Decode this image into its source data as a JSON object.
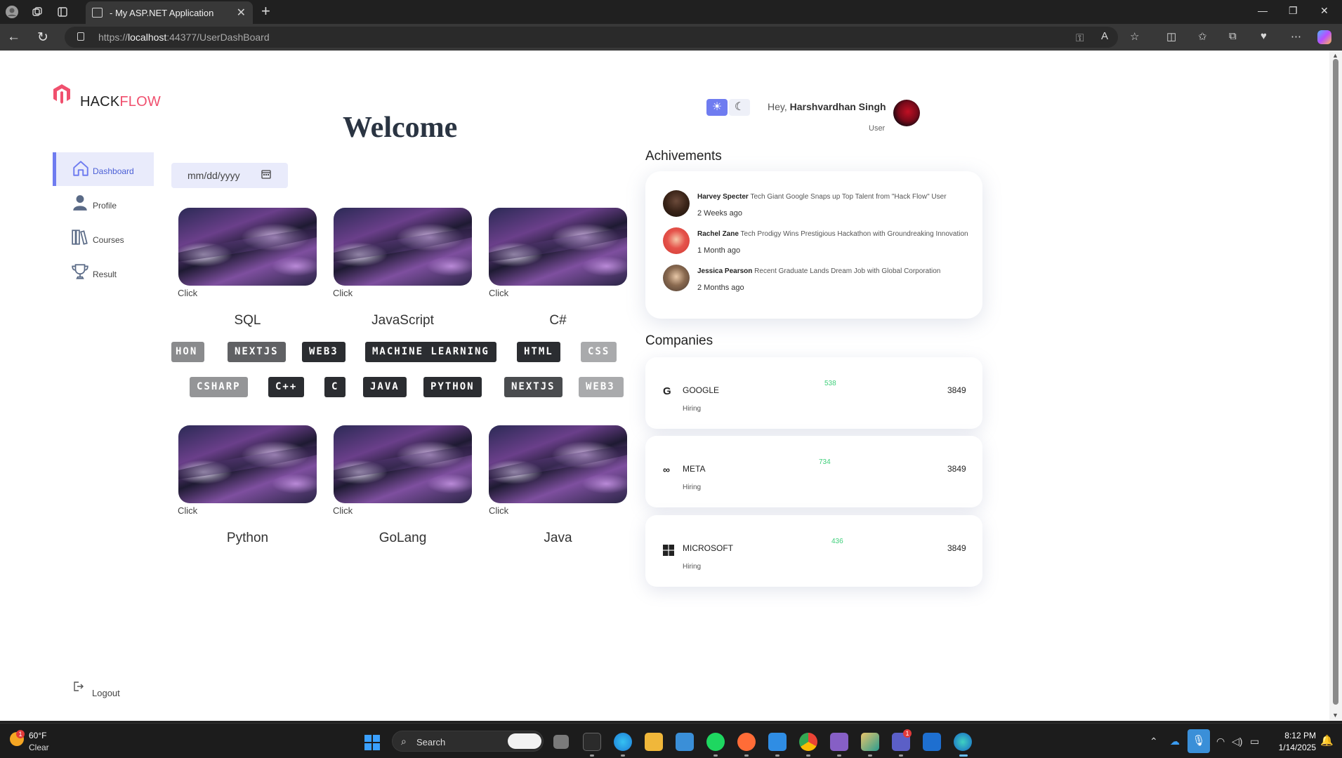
{
  "browser": {
    "tab_title": "- My ASP.NET Application",
    "url_prefix": "https://",
    "url_host": "localhost",
    "url_rest": ":44377/UserDashBoard"
  },
  "brand": {
    "name_part1": "HACK",
    "name_part2": "FLOW",
    "accent_color": "#f0506e"
  },
  "sidebar": {
    "items": [
      {
        "label": "Dashboard",
        "icon": "home-icon",
        "active": true
      },
      {
        "label": "Profile",
        "icon": "user-icon",
        "active": false
      },
      {
        "label": "Courses",
        "icon": "books-icon",
        "active": false
      },
      {
        "label": "Result",
        "icon": "trophy-icon",
        "active": false
      }
    ],
    "logout_label": "Logout"
  },
  "main": {
    "welcome": "Welcome",
    "date_placeholder": "mm/dd/yyyy",
    "click_label": "Click",
    "courses_row1": [
      "SQL",
      "JavaScript",
      "C#"
    ],
    "courses_row2": [
      "Python",
      "GoLang",
      "Java"
    ],
    "tags_row1": [
      "HON",
      "NEXTJS",
      "WEB3",
      "MACHINE LEARNING",
      "HTML",
      "CSS"
    ],
    "tags_row2": [
      "CSHARP",
      "C++",
      "C",
      "JAVA",
      "PYTHON",
      "NEXTJS",
      "WEB3"
    ]
  },
  "header": {
    "greeting": "Hey,",
    "user_name": "Harshvardhan Singh",
    "role": "User",
    "theme_light_icon": "sun-icon",
    "theme_dark_icon": "moon-icon"
  },
  "achievements": {
    "title": "Achivements",
    "items": [
      {
        "name": "Harvey Specter",
        "text": "Tech Giant Google Snaps up Top Talent from \"Hack Flow\" User",
        "time": "2 Weeks ago"
      },
      {
        "name": "Rachel Zane",
        "text": "Tech Prodigy Wins Prestigious Hackathon with Groundreaking Innovation",
        "time": "1 Month ago"
      },
      {
        "name": "Jessica Pearson",
        "text": "Recent Graduate Lands Dream Job with Global Corporation",
        "time": "2 Months ago"
      }
    ]
  },
  "companies": {
    "title": "Companies",
    "items": [
      {
        "name": "GOOGLE",
        "status": "Hiring",
        "count": "538",
        "value": "3849",
        "icon": "google-icon"
      },
      {
        "name": "META",
        "status": "Hiring",
        "count": "734",
        "value": "3849",
        "icon": "meta-icon"
      },
      {
        "name": "MICROSOFT",
        "status": "Hiring",
        "count": "436",
        "value": "3849",
        "icon": "microsoft-icon"
      }
    ],
    "count_color": "#3ecf7a"
  },
  "taskbar": {
    "temperature": "60°F",
    "condition": "Clear",
    "weather_badge": "1",
    "search_label": "Search",
    "time": "8:12 PM",
    "date": "1/14/2025",
    "teams_badge": "1"
  }
}
